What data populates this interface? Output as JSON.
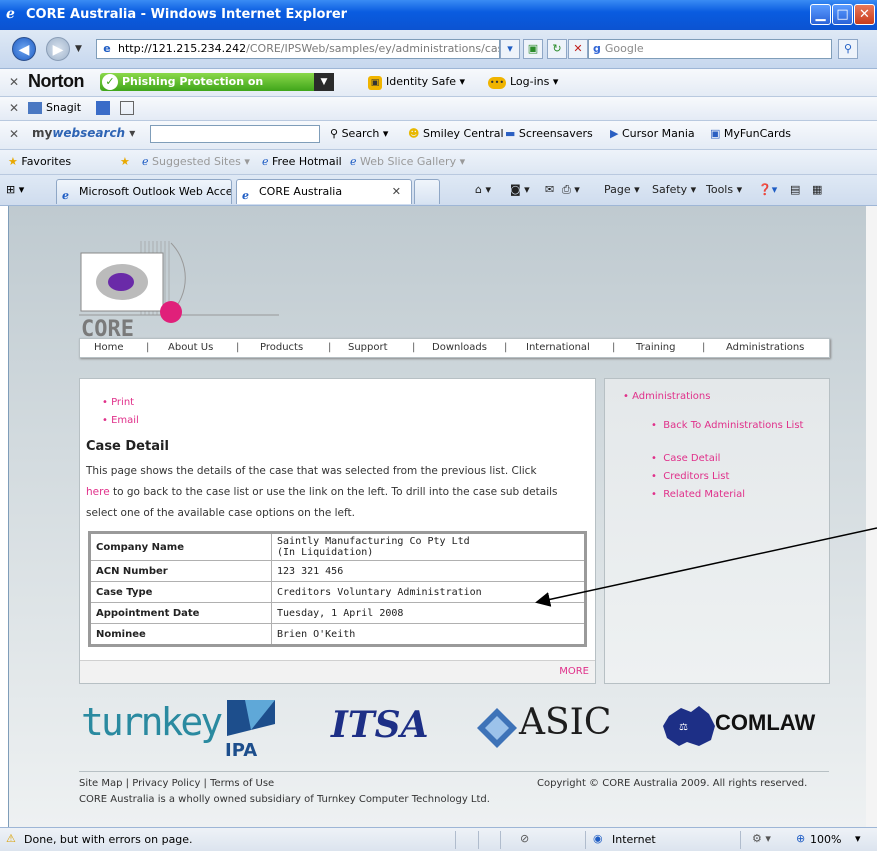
{
  "window": {
    "title": "CORE Australia - Windows Internet Explorer",
    "minimize_glyph": "▁",
    "maximize_glyph": "□",
    "close_glyph": "✕"
  },
  "address": {
    "url_host": "http://121.215.234.242",
    "url_path": "/CORE/IPSWeb/samples/ey/administrations/casedet",
    "search_placeholder": "Google"
  },
  "norton": {
    "logo": "Norton",
    "phishing": "Phishing Protection on",
    "identity_safe": "Identity Safe ▾",
    "logins": "Log-ins ▾"
  },
  "snagit": {
    "label": "Snagit"
  },
  "mywebsearch": {
    "logo_prefix": "my",
    "logo_main": "websearch",
    "search": "Search",
    "smiley": "Smiley Central",
    "screensavers": "Screensavers",
    "cursor": "Cursor Mania",
    "funcards": "MyFunCards"
  },
  "favorites": {
    "label": "Favorites",
    "suggested": "Suggested Sites ▾",
    "hotmail": "Free Hotmail",
    "webslice": "Web Slice Gallery ▾"
  },
  "tabs": [
    {
      "label": "Microsoft Outlook Web Access"
    },
    {
      "label": "CORE Australia"
    }
  ],
  "commands": {
    "page": "Page ▾",
    "safety": "Safety ▾",
    "tools": "Tools ▾"
  },
  "site": {
    "logo_text": "CORE",
    "menu": [
      "Home",
      "About Us",
      "Products",
      "Support",
      "Downloads",
      "International",
      "Training",
      "Administrations"
    ],
    "print": "Print",
    "email": "Email",
    "case_title": "Case Detail",
    "desc_1": "This page shows the details of the case that was selected from the previous list. Click",
    "desc_here": "here",
    "desc_2": " to go back to the case list or use the link on the left. To drill into the case sub details select one of the available case options on the left.",
    "table": [
      {
        "label": "Company Name",
        "value_1": "Saintly Manufacturing Co Pty Ltd",
        "value_2": "(In Liquidation)"
      },
      {
        "label": "ACN Number",
        "value_1": "123 321 456",
        "value_2": ""
      },
      {
        "label": "Case Type",
        "value_1": "Creditors Voluntary Administration",
        "value_2": ""
      },
      {
        "label": "Appointment Date",
        "value_1": "Tuesday, 1 April 2008",
        "value_2": ""
      },
      {
        "label": "Nominee",
        "value_1": "Brien O'Keith",
        "value_2": ""
      }
    ],
    "more": "MORE",
    "side": {
      "heading": "Administrations",
      "items": [
        "Back To Administrations List",
        "Case Detail",
        "Creditors List",
        "Related Material"
      ]
    },
    "partners": {
      "turnkey": "turnkey",
      "ipa": "IPA",
      "itsa": "ITSA",
      "asic": "ASIC",
      "comlaw": "COMLAW"
    },
    "footer": {
      "links": "Site Map | Privacy Policy | Terms of Use",
      "copyright": "Copyright © CORE Australia 2009. All rights reserved.",
      "subsidiary": "CORE Australia is a wholly owned subsidiary of Turnkey Computer Technology Ltd."
    }
  },
  "status": {
    "text": "Done, but with errors on page.",
    "zone": "Internet",
    "zoom": "100%"
  }
}
